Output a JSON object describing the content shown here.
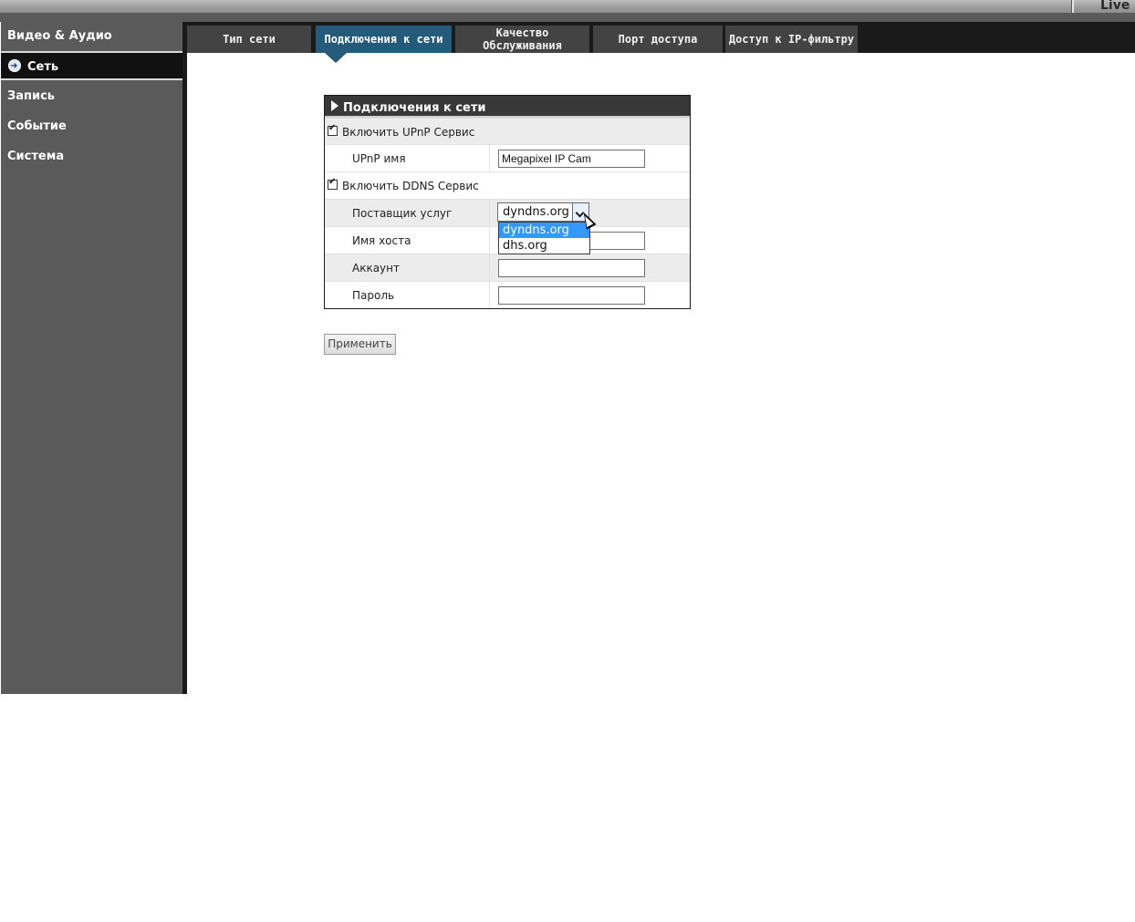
{
  "header": {
    "live_label": "Live"
  },
  "sidebar": {
    "items": [
      {
        "label": "Видео & Аудио",
        "active": false
      },
      {
        "label": "Сеть",
        "active": true
      },
      {
        "label": "Запись",
        "active": false
      },
      {
        "label": "Событие",
        "active": false
      },
      {
        "label": "Система",
        "active": false
      }
    ]
  },
  "tabs": [
    {
      "label": "Тип сети",
      "active": false
    },
    {
      "label": "Подключения к сети",
      "active": true
    },
    {
      "label": "Качество\nОбслуживания",
      "active": false
    },
    {
      "label": "Порт доступа",
      "active": false
    },
    {
      "label": "Доступ к IP-фильтру",
      "active": false
    }
  ],
  "panel": {
    "title": "Подключения к сети",
    "upnp_enable_label": "Включить UPnP Сервис",
    "upnp_enabled": true,
    "upnp_name_label": "UPnP имя",
    "upnp_name_value": "Megapixel IP Cam",
    "ddns_enable_label": "Включить DDNS Сервис",
    "ddns_enabled": true,
    "provider_label": "Поставщик услуг",
    "provider_value": "dyndns.org",
    "provider_options": [
      "dyndns.org",
      "dhs.org"
    ],
    "hostname_label": "Имя хоста",
    "hostname_value": "",
    "account_label": "Аккаунт",
    "account_value": "",
    "password_label": "Пароль",
    "password_value": ""
  },
  "apply_label": "Применить",
  "colors": {
    "active_tab": "#245a7a",
    "sidebar_bg": "#5a5a5a",
    "dropdown_highlight": "#3399ff"
  }
}
